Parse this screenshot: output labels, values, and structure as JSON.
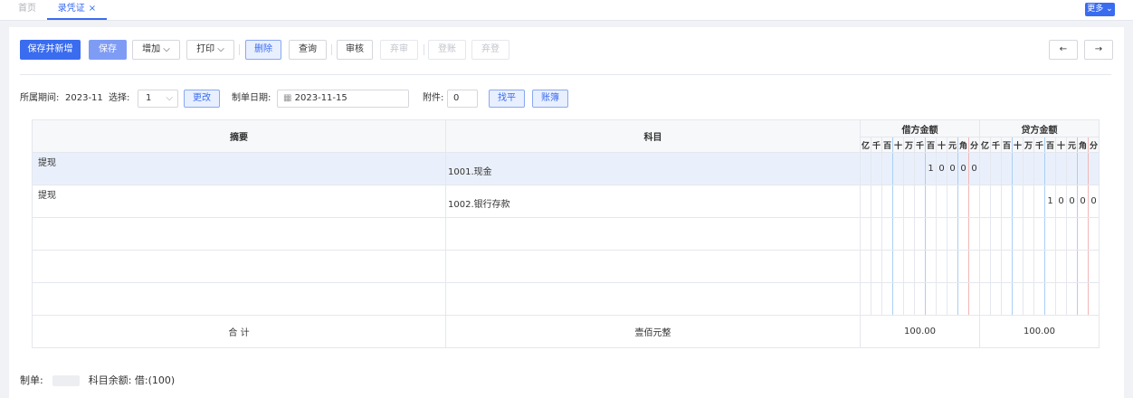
{
  "tabs": {
    "home": "首页",
    "active": "录凭证",
    "close": "×"
  },
  "more": {
    "label": "更多"
  },
  "toolbar": {
    "save_new": "保存并新增",
    "save": "保存",
    "add": "增加",
    "print": "打印",
    "delete": "删除",
    "query": "查询",
    "audit": "审核",
    "unaudit": "弃审",
    "post": "登账",
    "unpost": "弃登",
    "prev": "←",
    "next": "→"
  },
  "filters": {
    "period_label": "所属期间:",
    "period_value": "2023-11",
    "select_label": "选择:",
    "select_value": "1",
    "change": "更改",
    "date_label": "制单日期:",
    "date_value": "2023-11-15",
    "attach_label": "附件:",
    "attach_value": "0",
    "balance": "找平",
    "ledger": "账簿"
  },
  "table": {
    "col_summary": "摘要",
    "col_subject": "科目",
    "col_debit": "借方金额",
    "col_credit": "贷方金额",
    "digits": [
      "亿",
      "千",
      "百",
      "十",
      "万",
      "千",
      "百",
      "十",
      "元",
      "角",
      "分"
    ],
    "rows": [
      {
        "summary": "提现",
        "subject": "1001.现金",
        "debit": [
          "",
          "",
          "",
          "",
          "",
          "",
          "1",
          "0",
          "0",
          "0",
          "0"
        ],
        "credit": [
          "",
          "",
          "",
          "",
          "",
          "",
          "",
          "",
          "",
          "",
          ""
        ]
      },
      {
        "summary": "提现",
        "subject": "1002.银行存款",
        "debit": [
          "",
          "",
          "",
          "",
          "",
          "",
          "",
          "",
          "",
          "",
          ""
        ],
        "credit": [
          "",
          "",
          "",
          "",
          "",
          "",
          "1",
          "0",
          "0",
          "0",
          "0"
        ]
      },
      {
        "summary": "",
        "subject": "",
        "debit": [
          "",
          "",
          "",
          "",
          "",
          "",
          "",
          "",
          "",
          "",
          ""
        ],
        "credit": [
          "",
          "",
          "",
          "",
          "",
          "",
          "",
          "",
          "",
          "",
          ""
        ]
      },
      {
        "summary": "",
        "subject": "",
        "debit": [
          "",
          "",
          "",
          "",
          "",
          "",
          "",
          "",
          "",
          "",
          ""
        ],
        "credit": [
          "",
          "",
          "",
          "",
          "",
          "",
          "",
          "",
          "",
          "",
          ""
        ]
      },
      {
        "summary": "",
        "subject": "",
        "debit": [
          "",
          "",
          "",
          "",
          "",
          "",
          "",
          "",
          "",
          "",
          ""
        ],
        "credit": [
          "",
          "",
          "",
          "",
          "",
          "",
          "",
          "",
          "",
          "",
          ""
        ]
      }
    ],
    "total_label": "合 计",
    "total_words": "壹佰元整",
    "total_debit": "100.00",
    "total_credit": "100.00"
  },
  "footer": {
    "maker_label": "制单:",
    "balance_text": "科目余额: 借:(100)"
  }
}
